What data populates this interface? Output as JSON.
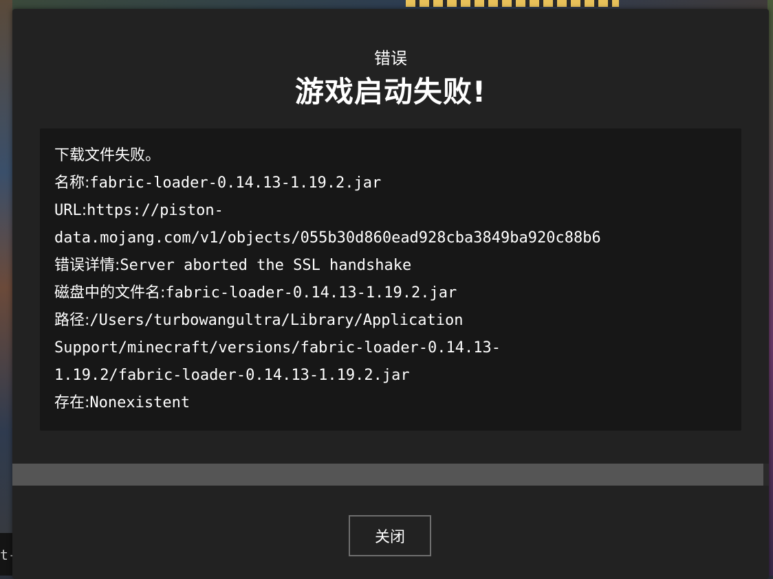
{
  "dialog": {
    "subtitle": "错误",
    "title": "游戏启动失败!",
    "message": {
      "line1": "下载文件失败。",
      "name_label": "名称:",
      "name_value": "fabric-loader-0.14.13-1.19.2.jar",
      "url_label": "URL:",
      "url_value_part1": "https://piston-",
      "url_value_part2": "data.mojang.com/v1/objects/055b30d860ead928cba3849ba920c88b6",
      "error_label": "错误详情:",
      "error_value": "Server aborted the SSL handshake",
      "disk_label": "磁盘中的文件名:",
      "disk_value": "fabric-loader-0.14.13-1.19.2.jar",
      "path_label": "路径:",
      "path_value_part1": "/Users/turbowangultra/Library/Application",
      "path_value_part2": "Support/minecraft/versions/fabric-loader-0.14.13-",
      "path_value_part3": "1.19.2/fabric-loader-0.14.13-1.19.2.jar",
      "exists_label": "存在:",
      "exists_value": "Nonexistent"
    },
    "close_label": "关闭"
  },
  "background": {
    "partial_text": "t-l"
  },
  "colors": {
    "dialog_bg": "#222222",
    "message_bg": "#171717",
    "text": "#ffffff",
    "scrollbar_thumb": "#555555",
    "button_border": "#6f6f6f"
  }
}
